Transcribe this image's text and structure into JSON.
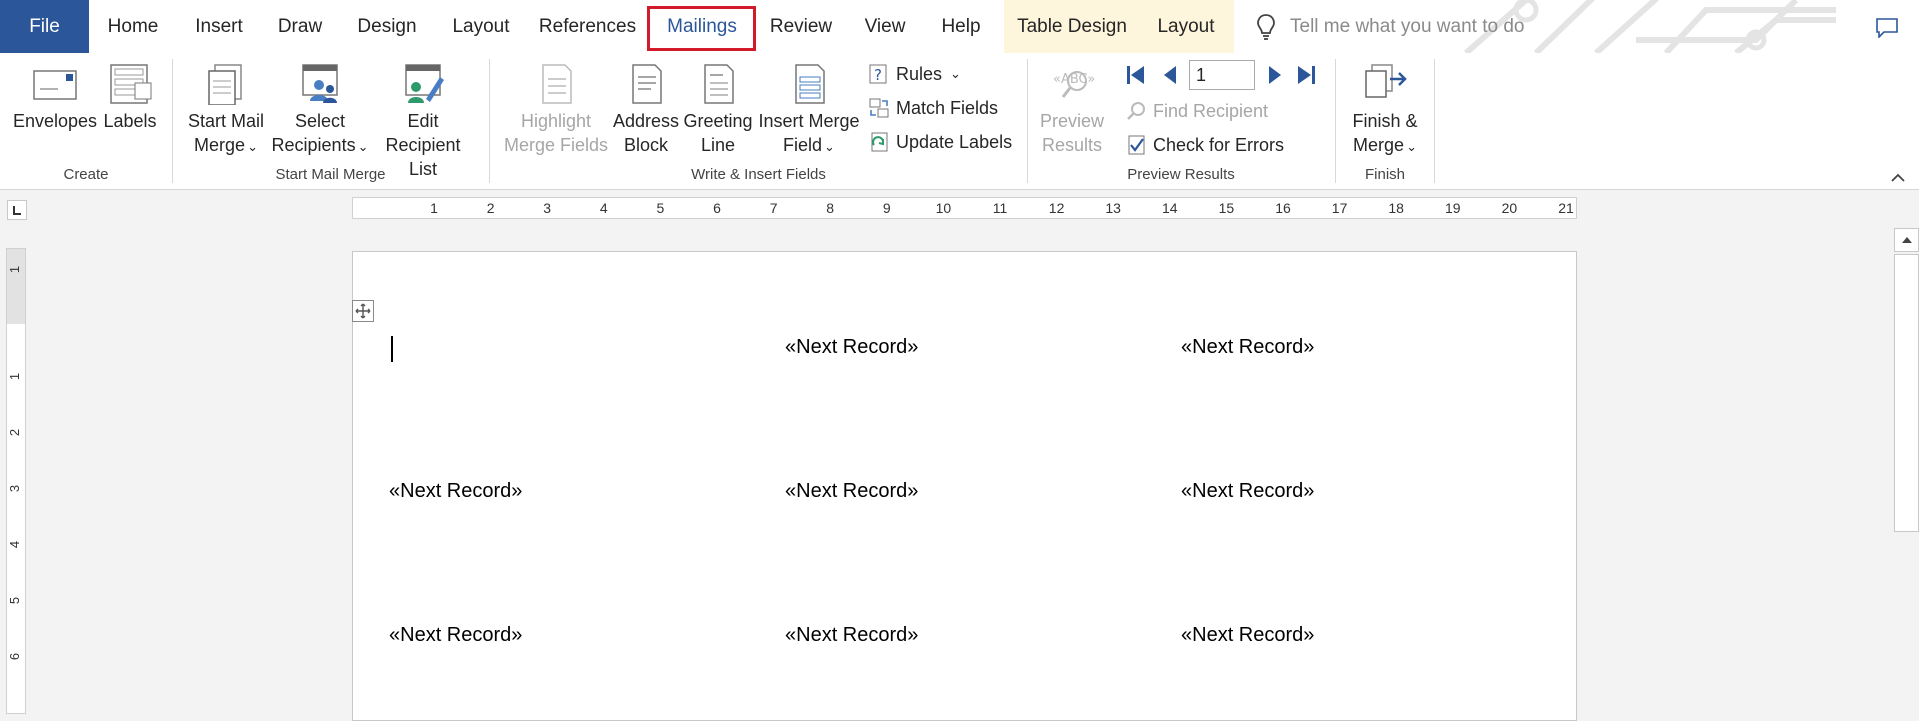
{
  "tabs": {
    "file": "File",
    "home": "Home",
    "insert": "Insert",
    "draw": "Draw",
    "design": "Design",
    "layout": "Layout",
    "references": "References",
    "mailings": "Mailings",
    "review": "Review",
    "view": "View",
    "help": "Help",
    "table_design": "Table Design",
    "table_layout": "Layout",
    "tell_me_placeholder": "Tell me what you want to do"
  },
  "ribbon": {
    "create": {
      "label": "Create",
      "envelopes": "Envelopes",
      "labels": "Labels"
    },
    "start_mail_merge": {
      "label": "Start Mail Merge",
      "start_line1": "Start Mail",
      "start_line2": "Merge",
      "select_line1": "Select",
      "select_line2": "Recipients",
      "edit_line1": "Edit",
      "edit_line2": "Recipient List"
    },
    "write_insert": {
      "label": "Write & Insert Fields",
      "highlight_line1": "Highlight",
      "highlight_line2": "Merge Fields",
      "address_line1": "Address",
      "address_line2": "Block",
      "greeting_line1": "Greeting",
      "greeting_line2": "Line",
      "insert_field_line1": "Insert Merge",
      "insert_field_line2": "Field",
      "rules": "Rules",
      "match_fields": "Match Fields",
      "update_labels": "Update Labels"
    },
    "preview": {
      "label": "Preview Results",
      "preview_line1": "Preview",
      "preview_line2": "Results",
      "record_value": "1",
      "find_recipient": "Find Recipient",
      "check_errors": "Check for Errors"
    },
    "finish": {
      "label": "Finish",
      "finish_line1": "Finish &",
      "finish_line2": "Merge"
    }
  },
  "ruler": {
    "numbers": [
      "1",
      "2",
      "3",
      "4",
      "5",
      "6",
      "7",
      "8",
      "9",
      "10",
      "11",
      "12",
      "13",
      "14",
      "15",
      "16",
      "17",
      "18",
      "19",
      "20",
      "21"
    ]
  },
  "vruler": {
    "numbers": [
      "1",
      "1",
      "2",
      "3",
      "4",
      "5",
      "6"
    ]
  },
  "document": {
    "fields": [
      "«Next Record»",
      "«Next Record»",
      "«Next Record»",
      "«Next Record»",
      "«Next Record»",
      "«Next Record»",
      "«Next Record»",
      "«Next Record»"
    ]
  },
  "colors": {
    "file_tab": "#2b579a",
    "active_tab_text": "#2b579a",
    "highlight_box": "#d11a2a",
    "contextual_tab_bg": "#fdf5dc"
  }
}
